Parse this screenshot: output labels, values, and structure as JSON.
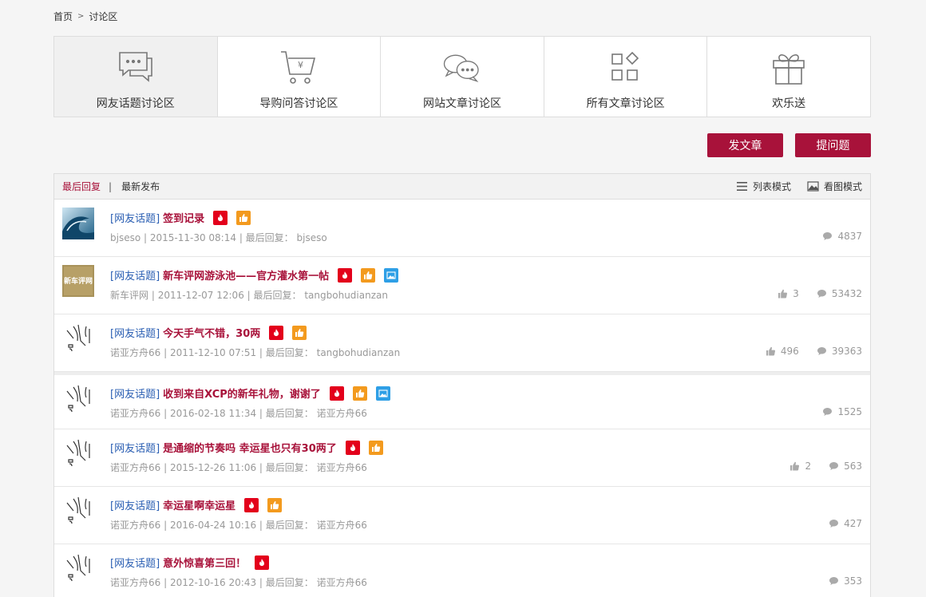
{
  "breadcrumb": {
    "home": "首页",
    "separator": ">",
    "current": "讨论区"
  },
  "categories": [
    {
      "label": "网友话题讨论区",
      "icon": "chat-bubble-icon"
    },
    {
      "label": "导购问答讨论区",
      "icon": "shopping-cart-icon"
    },
    {
      "label": "网站文章讨论区",
      "icon": "double-chat-icon"
    },
    {
      "label": "所有文章讨论区",
      "icon": "grid-apps-icon"
    },
    {
      "label": "欢乐送",
      "icon": "gift-icon"
    }
  ],
  "actions": {
    "post_article": "发文章",
    "ask_question": "提问题"
  },
  "list_head": {
    "tabs": [
      "最后回复",
      "最新发布"
    ],
    "separator": "|",
    "view_list": "列表模式",
    "view_image": "看图模式"
  },
  "threads": [
    {
      "tag": "[网友话题]",
      "title": "签到记录",
      "author": "bjseso",
      "date": "2015-11-30 08:14",
      "last_label": "最后回复：",
      "last_reply": "bjseso",
      "likes": "",
      "comments": "4837",
      "badges": [
        "hot",
        "like"
      ],
      "avatar": "wave-avatar"
    },
    {
      "tag": "[网友话题]",
      "title": "新车评网游泳池——官方灌水第一帖",
      "author": "新车评网",
      "date": "2011-12-07 12:06",
      "last_label": "最后回复：",
      "last_reply": "tangbohudianzan",
      "likes": "3",
      "comments": "53432",
      "badges": [
        "hot",
        "like",
        "pic"
      ],
      "avatar": "xincheping-avatar",
      "avatar_text": "新车评网"
    },
    {
      "tag": "[网友话题]",
      "title": "今天手气不错，30两",
      "author": "诺亚方舟66",
      "date": "2011-12-10 07:51",
      "last_label": "最后回复：",
      "last_reply": "tangbohudianzan",
      "likes": "496",
      "comments": "39363",
      "badges": [
        "hot",
        "like"
      ],
      "avatar": "sketch-avatar"
    },
    {
      "tag": "[网友话题]",
      "title": "收到来自XCP的新年礼物，谢谢了",
      "author": "诺亚方舟66",
      "date": "2016-02-18 11:34",
      "last_label": "最后回复：",
      "last_reply": "诺亚方舟66",
      "likes": "",
      "comments": "1525",
      "badges": [
        "hot",
        "like",
        "pic"
      ],
      "avatar": "sketch-avatar"
    },
    {
      "tag": "[网友话题]",
      "title": "是通缩的节奏吗 幸运星也只有30两了",
      "author": "诺亚方舟66",
      "date": "2015-12-26 11:06",
      "last_label": "最后回复：",
      "last_reply": "诺亚方舟66",
      "likes": "2",
      "comments": "563",
      "badges": [
        "hot",
        "like"
      ],
      "avatar": "sketch-avatar"
    },
    {
      "tag": "[网友话题]",
      "title": "幸运星啊幸运星",
      "author": "诺亚方舟66",
      "date": "2016-04-24 10:16",
      "last_label": "最后回复：",
      "last_reply": "诺亚方舟66",
      "likes": "",
      "comments": "427",
      "badges": [
        "hot",
        "like"
      ],
      "avatar": "sketch-avatar"
    },
    {
      "tag": "[网友话题]",
      "title": "意外惊喜第三回！",
      "author": "诺亚方舟66",
      "date": "2012-10-16 20:43",
      "last_label": "最后回复：",
      "last_reply": "诺亚方舟66",
      "likes": "",
      "comments": "353",
      "badges": [
        "hot"
      ],
      "avatar": "sketch-avatar"
    }
  ],
  "colors": {
    "accent": "#a8123a",
    "tag": "#2b5fb3",
    "hot": "#e3001b",
    "like": "#f39a1e",
    "pic": "#2e9fe6"
  }
}
